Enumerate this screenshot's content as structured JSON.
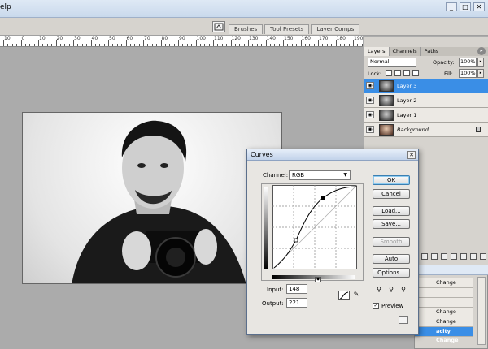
{
  "app": {
    "menu_fragment": "elp",
    "window_buttons": [
      "_",
      "□",
      "✕"
    ]
  },
  "palette_well": {
    "tabs": [
      "Brushes",
      "Tool Presets",
      "Layer Comps"
    ]
  },
  "ruler": {
    "labels": [
      "10",
      "0",
      "10",
      "20",
      "30",
      "40",
      "50",
      "60",
      "70",
      "80",
      "90",
      "100",
      "110",
      "120",
      "130",
      "140",
      "150",
      "160",
      "170",
      "180",
      "190"
    ]
  },
  "layers_panel": {
    "tabs": [
      "Layers",
      "Channels",
      "Paths"
    ],
    "blend_mode": "Normal",
    "opacity_label": "Opacity:",
    "opacity_value": "100%",
    "lock_label": "Lock:",
    "fill_label": "Fill:",
    "fill_value": "100%",
    "layers": [
      {
        "name": "Layer 3",
        "selected": true
      },
      {
        "name": "Layer 2",
        "selected": false
      },
      {
        "name": "Layer 1",
        "selected": false
      },
      {
        "name": "Background",
        "selected": false,
        "locked": true
      }
    ]
  },
  "history_panel": {
    "items": [
      "Change",
      "",
      "",
      "Change",
      "Change",
      "acity Change"
    ]
  },
  "curves_dialog": {
    "title": "Curves",
    "close_symbol": "✕",
    "channel_label": "Channel:",
    "channel_value": "RGB",
    "input_label": "Input:",
    "input_value": "148",
    "output_label": "Output:",
    "output_value": "221",
    "buttons": {
      "ok": "OK",
      "cancel": "Cancel",
      "load": "Load...",
      "save": "Save...",
      "smooth": "Smooth",
      "auto": "Auto",
      "options": "Options..."
    },
    "preview_label": "Preview",
    "preview_checked": true
  }
}
